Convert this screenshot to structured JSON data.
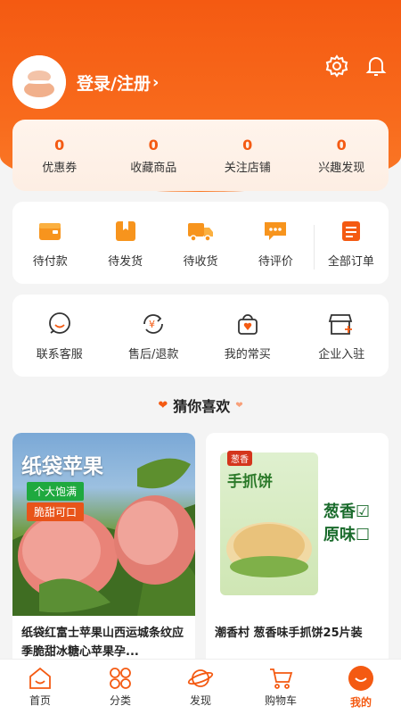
{
  "header": {
    "login_text": "登录/注册",
    "chevron": "›",
    "icons": [
      "settings-icon",
      "bell-icon"
    ]
  },
  "stats": [
    {
      "value": "0",
      "label": "优惠券"
    },
    {
      "value": "0",
      "label": "收藏商品"
    },
    {
      "value": "0",
      "label": "关注店铺"
    },
    {
      "value": "0",
      "label": "兴趣发现"
    }
  ],
  "orders": [
    {
      "label": "待付款",
      "icon": "wallet-icon"
    },
    {
      "label": "待发货",
      "icon": "package-icon"
    },
    {
      "label": "待收货",
      "icon": "truck-icon"
    },
    {
      "label": "待评价",
      "icon": "comment-icon"
    },
    {
      "label": "全部订单",
      "icon": "order-list-icon"
    }
  ],
  "services": [
    {
      "label": "联系客服",
      "icon": "customer-service-icon"
    },
    {
      "label": "售后/退款",
      "icon": "refund-icon"
    },
    {
      "label": "我的常买",
      "icon": "shopping-bag-icon"
    },
    {
      "label": "企业入驻",
      "icon": "store-icon"
    }
  ],
  "recommend": {
    "title": "猜你喜欢"
  },
  "products": [
    {
      "title": "纸袋红富士苹果山西运城条纹应季脆甜冰糖心苹果孕...",
      "image_text": {
        "main": "纸袋苹果",
        "tag1": "个大饱满",
        "tag2": "脆甜可口"
      }
    },
    {
      "title": "潮香村 葱香味手抓饼25片装",
      "image_text": {
        "brand": "葱香",
        "main": "手抓饼",
        "flavor1": "葱香☑",
        "flavor2": "原味☐"
      }
    }
  ],
  "tabbar": [
    {
      "label": "首页",
      "icon": "home-icon",
      "active": false
    },
    {
      "label": "分类",
      "icon": "category-icon",
      "active": false
    },
    {
      "label": "发现",
      "icon": "planet-icon",
      "active": false
    },
    {
      "label": "购物车",
      "icon": "cart-icon",
      "active": false
    },
    {
      "label": "我的",
      "icon": "profile-icon",
      "active": true
    }
  ],
  "colors": {
    "accent": "#f45a12"
  }
}
